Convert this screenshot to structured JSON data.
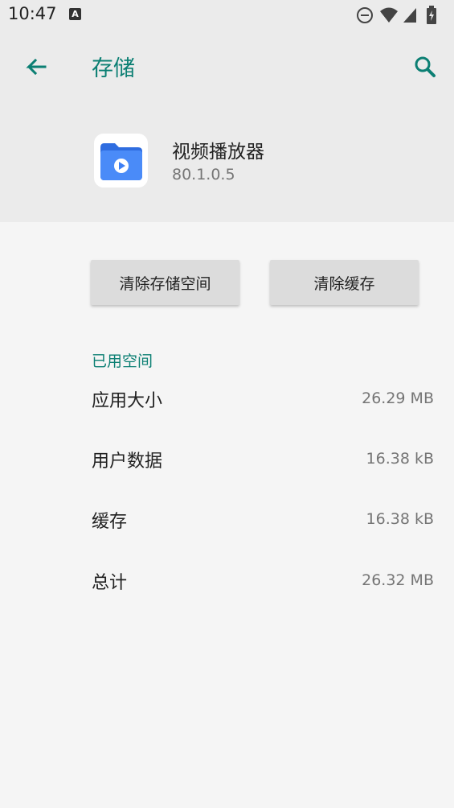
{
  "status_bar": {
    "time": "10:47",
    "notification_icon": "a-icon",
    "icons": [
      "do-not-disturb-icon",
      "wifi-icon",
      "signal-icon",
      "battery-icon"
    ]
  },
  "app_bar": {
    "back_icon": "arrow-back-icon",
    "title": "存储",
    "search_icon": "search-icon"
  },
  "app_info": {
    "icon": "video-folder-icon",
    "name": "视频播放器",
    "version": "80.1.0.5"
  },
  "actions": {
    "clear_storage": "清除存储空间",
    "clear_cache": "清除缓存"
  },
  "storage": {
    "section_title": "已用空间",
    "rows": [
      {
        "label": "应用大小",
        "value": "26.29 MB"
      },
      {
        "label": "用户数据",
        "value": "16.38 kB"
      },
      {
        "label": "缓存",
        "value": "16.38 kB"
      },
      {
        "label": "总计",
        "value": "26.32 MB"
      }
    ]
  },
  "colors": {
    "accent": "#0b7f73",
    "header_bg": "#ebebeb",
    "body_bg": "#f5f5f5",
    "button_bg": "#dcdcdc",
    "app_icon_blue": "#3d7ff5"
  }
}
